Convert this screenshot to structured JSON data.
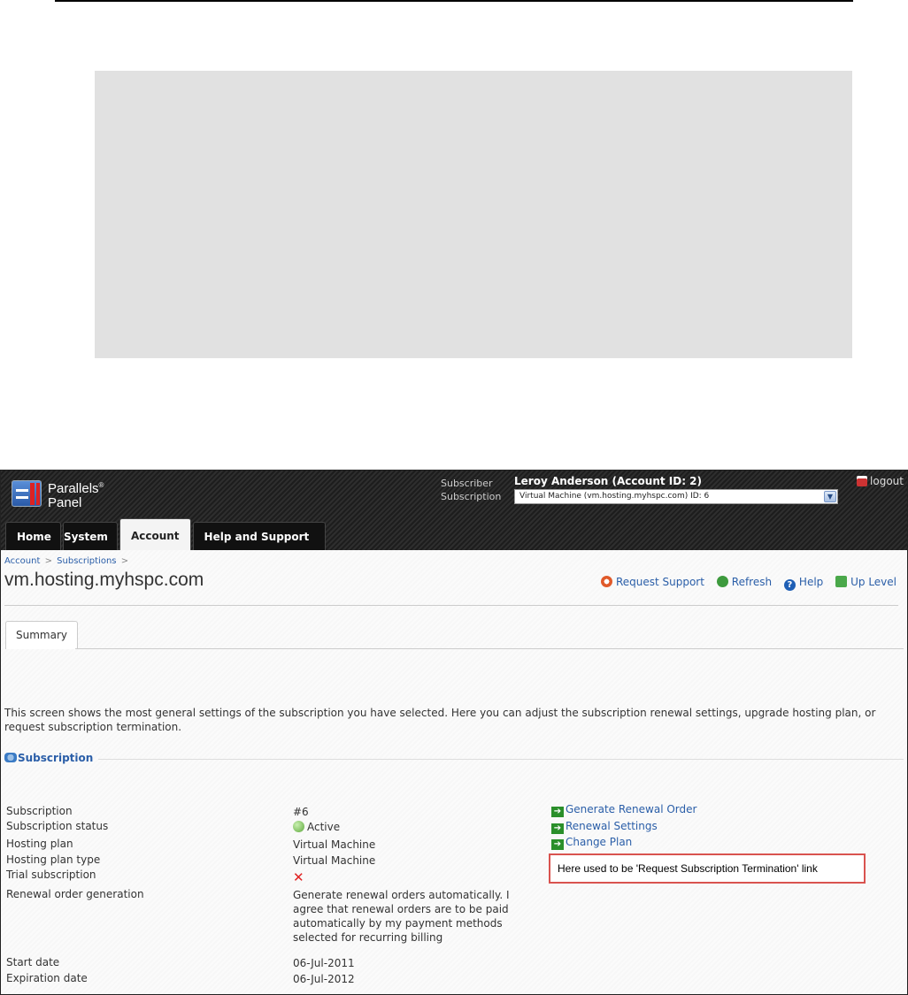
{
  "header": {
    "logo_line1": "Parallels",
    "logo_reg": "®",
    "logo_line2": "Panel",
    "subscriber_label": "Subscriber",
    "subscription_label": "Subscription",
    "subscriber_name": "Leroy Anderson (Account ID: 2)",
    "subscription_selected": "Virtual Machine (vm.hosting.myhspc.com) ID: 6",
    "logout_label": "logout"
  },
  "nav": {
    "tabs": [
      {
        "label": "Home"
      },
      {
        "label": "System"
      },
      {
        "label": "Account"
      },
      {
        "label": "Help and Support"
      }
    ],
    "active": "Account"
  },
  "breadcrumb": {
    "items": [
      "Account",
      "Subscriptions"
    ],
    "separator": ">"
  },
  "page": {
    "title": "vm.hosting.myhspc.com",
    "actions": [
      {
        "label": "Request Support",
        "icon": "lifebuoy-icon"
      },
      {
        "label": "Refresh",
        "icon": "refresh-icon"
      },
      {
        "label": "Help",
        "icon": "help-icon"
      },
      {
        "label": "Up Level",
        "icon": "up-level-icon"
      }
    ],
    "tab_summary": "Summary",
    "intro": "This screen shows the most general settings of the subscription you have selected. Here you can adjust the subscription renewal settings, upgrade hosting plan, or request subscription termination."
  },
  "subscription": {
    "section_title": "Subscription",
    "rows": [
      {
        "label": "Subscription",
        "value": "#6"
      },
      {
        "label": "Subscription status",
        "value": "Active"
      },
      {
        "label": "Hosting plan",
        "value": "Virtual Machine"
      },
      {
        "label": "Hosting plan type",
        "value": "Virtual Machine"
      },
      {
        "label": "Trial subscription",
        "value": "✕"
      },
      {
        "label": "Renewal order generation",
        "value": "Generate renewal orders automatically. I agree that renewal orders are to be paid automatically by my payment methods selected for recurring billing"
      },
      {
        "label": "Start date",
        "value": "06-Jul-2011"
      },
      {
        "label": "Expiration date",
        "value": "06-Jul-2012"
      }
    ],
    "links": [
      {
        "label": "Generate Renewal Order"
      },
      {
        "label": "Renewal Settings"
      },
      {
        "label": "Change Plan"
      }
    ],
    "note": "Here used to be 'Request Subscription Termination' link"
  },
  "colors": {
    "link": "#2a5ea8",
    "note_border": "#d9534f",
    "header_bg": "#1d1d1d"
  }
}
